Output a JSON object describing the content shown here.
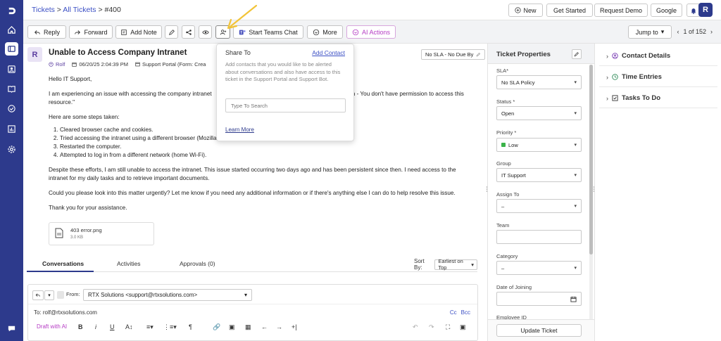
{
  "header": {
    "breadcrumb": {
      "tickets": "Tickets",
      "sep1": " > ",
      "all_tickets": "All Tickets",
      "sep2": " > ",
      "ticket_no": "#400"
    },
    "new_label": "New",
    "get_started_label": "Get Started",
    "request_demo_label": "Request Demo",
    "google_label": "Google",
    "user_initial": "R"
  },
  "toolbar": {
    "reply_label": "Reply",
    "forward_label": "Forward",
    "add_note_label": "Add Note",
    "teams_label": "Start Teams Chat",
    "more_label": "More",
    "ai_label": "AI Actions",
    "jump_label": "Jump to",
    "pager_text": "1 of 152"
  },
  "ticket": {
    "avatar_initial": "R",
    "title": "Unable to Access Company Intranet",
    "requester": "Rolf",
    "date": "06/20/25 2:04:39 PM",
    "source": "Support Portal (Form: Crea",
    "sla_chip": "No SLA - No Due By",
    "greeting": "Hello IT Support,",
    "para1a": "I am experiencing an issue with accessing the company intranet",
    "para1b": "saying \"403 Forbidden - You don't have permission to access this resource.\"",
    "steps_intro": "Here are some steps taken:",
    "steps": [
      "Cleared browser cache and cookies.",
      "Tried accessing the intranet using a different browser (Mozilla Firefox).",
      "Restarted the computer.",
      "Attempted to log in from a different network (home Wi-Fi)."
    ],
    "para2": "Despite these efforts, I am still unable to access the intranet. This issue started occurring two days ago and has been persistent since then. I need access to the intranet for my daily tasks and to retrieve important documents.",
    "para3": "Could you please look into this matter urgently? Let me know if you need any additional information or if there's anything else I can do to help resolve this issue.",
    "closing": "Thank you for your assistance.",
    "attachment": {
      "name": "403 error.png",
      "size": "3.0 KB"
    }
  },
  "tabs": {
    "conversations": "Conversations",
    "activities": "Activities",
    "approvals": "Approvals (0)",
    "sort_by_label": "Sort By:",
    "sort_value": "Earliest on Top"
  },
  "reply": {
    "from_label": "From:",
    "from_value": "RTX Solutions <support@rtxsolutions.com>",
    "to_line": "To: rolf@rtxsolutions.com",
    "cc": "Cc",
    "bcc": "Bcc",
    "draft_ai": "Draft with AI"
  },
  "share_popover": {
    "title": "Share To",
    "add_contact": "Add Contact",
    "description": "Add contacts that you would like to be alerted about conversations and also have access to this ticket in the Support Portal and Support Bot.",
    "search_placeholder": "Type To Search",
    "learn_more": "Learn More"
  },
  "properties": {
    "title": "Ticket Properties",
    "sla_label": "SLA*",
    "sla_value": "No SLA Policy",
    "status_label": "Status *",
    "status_value": "Open",
    "priority_label": "Priority *",
    "priority_value": "Low",
    "group_label": "Group",
    "group_value": "IT Support",
    "assign_label": "Assign To",
    "assign_value": "–",
    "team_label": "Team",
    "category_label": "Category",
    "category_value": "–",
    "doj_label": "Date of Joining",
    "emp_label": "Employee ID",
    "update_label": "Update Ticket"
  },
  "right_panel": {
    "contact_details": "Contact Details",
    "time_entries": "Time Entries",
    "tasks": "Tasks To Do"
  },
  "colors": {
    "nav": "#2d3a8c",
    "accent": "#3b4fc4",
    "ai": "#b53bc4",
    "priority_low": "#3bb34a",
    "arrow": "#f2c438"
  }
}
